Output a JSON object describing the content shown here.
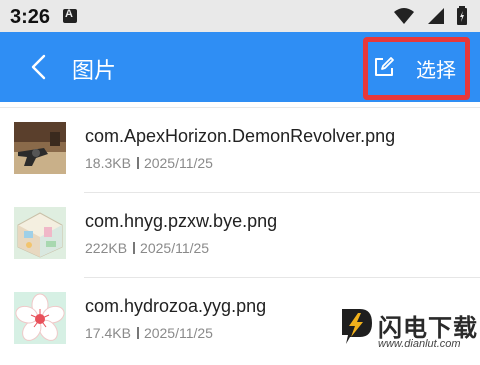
{
  "status_bar": {
    "time": "3:26",
    "icons": [
      "notification-a-icon",
      "wifi-icon",
      "signal-icon",
      "battery-charging-icon"
    ]
  },
  "app_bar": {
    "back_icon": "chevron-left-icon",
    "title": "图片",
    "select_icon": "edit-icon",
    "select_label": "选择",
    "background": "#2f8ef4",
    "highlight_color": "#e8383a"
  },
  "files": [
    {
      "name": "com.ApexHorizon.DemonRevolver.png",
      "size": "18.3KB",
      "date": "2025/11/25",
      "thumb": "revolver-thumbnail"
    },
    {
      "name": "com.hnyg.pzxw.bye.png",
      "size": "222KB",
      "date": "2025/11/25",
      "thumb": "room-thumbnail"
    },
    {
      "name": "com.hydrozoa.yyg.png",
      "size": "17.4KB",
      "date": "2025/11/25",
      "thumb": "flower-thumbnail"
    }
  ],
  "watermark": {
    "text": "闪电下载",
    "url": "www.dianlut.com"
  }
}
